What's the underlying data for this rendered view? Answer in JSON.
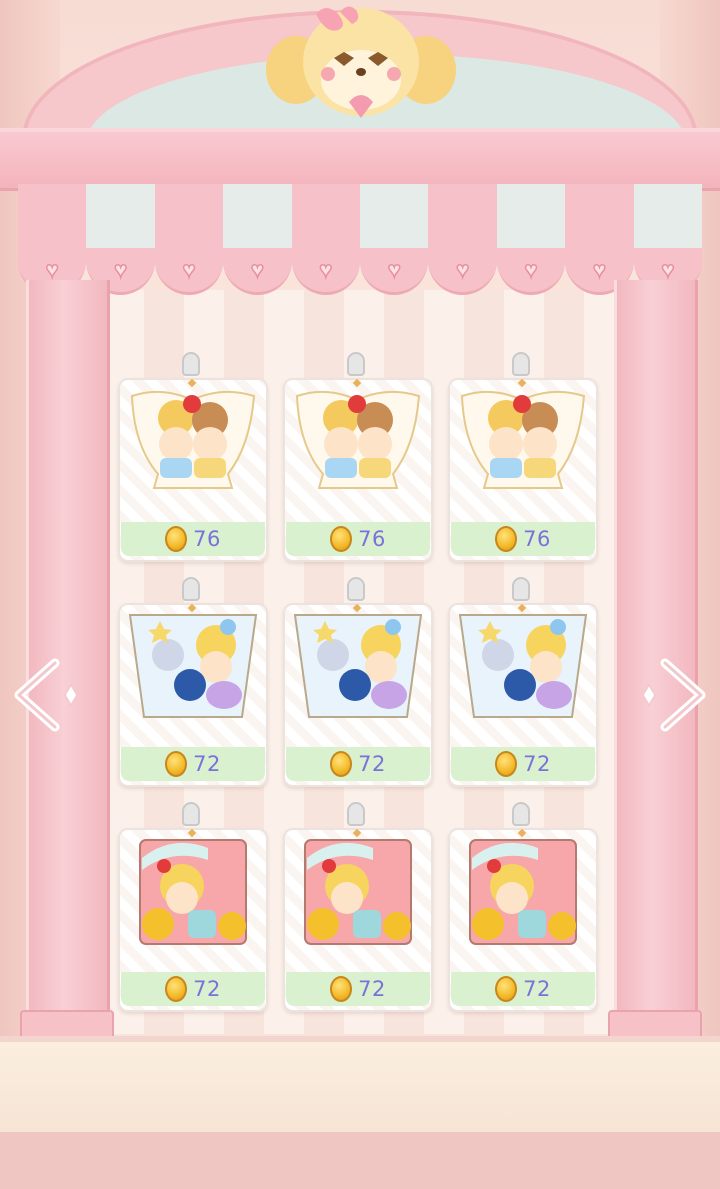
{
  "shop": {
    "items": [
      {
        "price": "76",
        "art": "teacup-chibi-bears"
      },
      {
        "price": "76",
        "art": "teacup-chibi-bears"
      },
      {
        "price": "76",
        "art": "teacup-chibi-bears"
      },
      {
        "price": "72",
        "art": "bucket-chibi-stars"
      },
      {
        "price": "72",
        "art": "bucket-chibi-stars"
      },
      {
        "price": "72",
        "art": "bucket-chibi-stars"
      },
      {
        "price": "72",
        "art": "square-chibi-strawberry"
      },
      {
        "price": "72",
        "art": "square-chibi-strawberry"
      },
      {
        "price": "72",
        "art": "square-chibi-strawberry"
      }
    ]
  },
  "icons": {
    "nav_prev": "chevron-left-sparkle-icon",
    "nav_next": "chevron-right-sparkle-icon",
    "currency": "gold-coin-icon"
  },
  "colors": {
    "price_text": "#7a72d8",
    "price_bar": "#d9f1cf",
    "frame_pink": "#f6c1c8"
  }
}
